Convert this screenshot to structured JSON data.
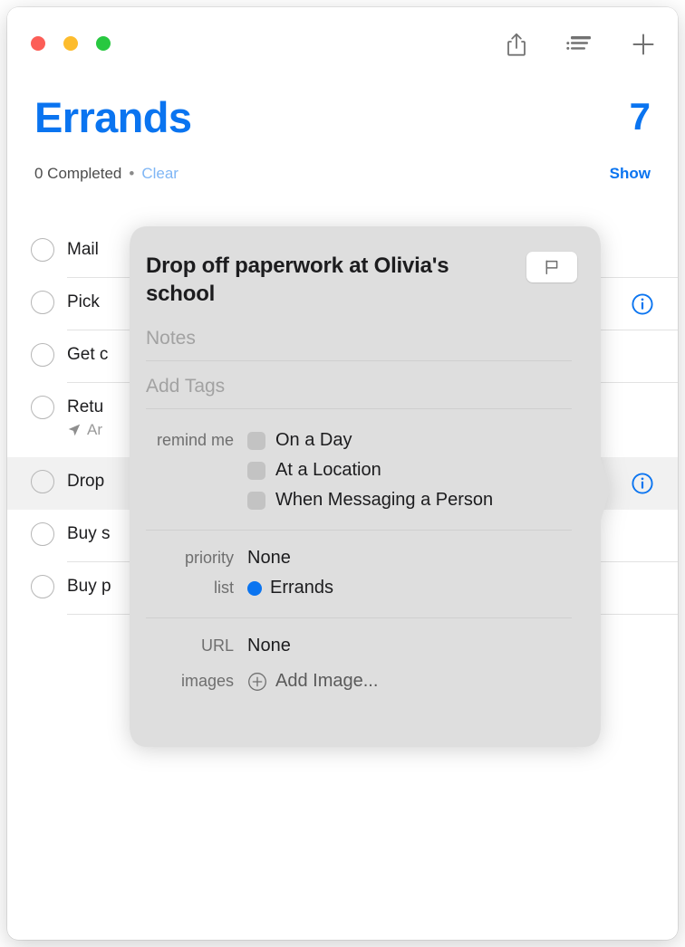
{
  "window": {
    "traffic_lights": [
      {
        "name": "close",
        "color": "#fc5e57"
      },
      {
        "name": "minimize",
        "color": "#fdbc2d"
      },
      {
        "name": "zoom",
        "color": "#28c840"
      }
    ]
  },
  "toolbar": {
    "buttons": [
      {
        "icon": "share-icon",
        "label": "Share"
      },
      {
        "icon": "list-view-icon",
        "label": "View Options"
      },
      {
        "icon": "plus-icon",
        "label": "New Reminder"
      }
    ]
  },
  "header": {
    "title": "Errands",
    "count": "7",
    "completed_text": "0 Completed",
    "separator": "•",
    "clear_label": "Clear",
    "show_label": "Show",
    "accent_color": "#0a74f0",
    "clear_color": "#7fb6f5"
  },
  "list": {
    "items": [
      {
        "title": "Mail",
        "subtitle": "",
        "selected": false,
        "info": false
      },
      {
        "title": "Pick",
        "subtitle": "",
        "selected": false,
        "info": true
      },
      {
        "title": "Get c",
        "subtitle": "",
        "selected": false,
        "info": false
      },
      {
        "title": "Retu",
        "subtitle": "Ar",
        "selected": false,
        "info": false
      },
      {
        "title": "Drop",
        "subtitle": "",
        "selected": true,
        "info": true
      },
      {
        "title": "Buy s",
        "subtitle": "",
        "selected": false,
        "info": false
      },
      {
        "title": "Buy p",
        "subtitle": "",
        "selected": false,
        "info": false
      }
    ]
  },
  "popover": {
    "title": "Drop off paperwork at Olivia's school",
    "flag_icon": "flag-icon",
    "notes_placeholder": "Notes",
    "tags_placeholder": "Add Tags",
    "remind_me_label": "remind me",
    "remind_options": [
      {
        "label": "On a Day",
        "checked": false
      },
      {
        "label": "At a Location",
        "checked": false
      },
      {
        "label": "When Messaging a Person",
        "checked": false
      }
    ],
    "priority_label": "priority",
    "priority_value": "None",
    "list_label": "list",
    "list_value": "Errands",
    "list_color": "#0a74f0",
    "url_label": "URL",
    "url_value": "None",
    "images_label": "images",
    "add_image_label": "Add Image...",
    "add_image_icon": "plus-circle-icon"
  }
}
